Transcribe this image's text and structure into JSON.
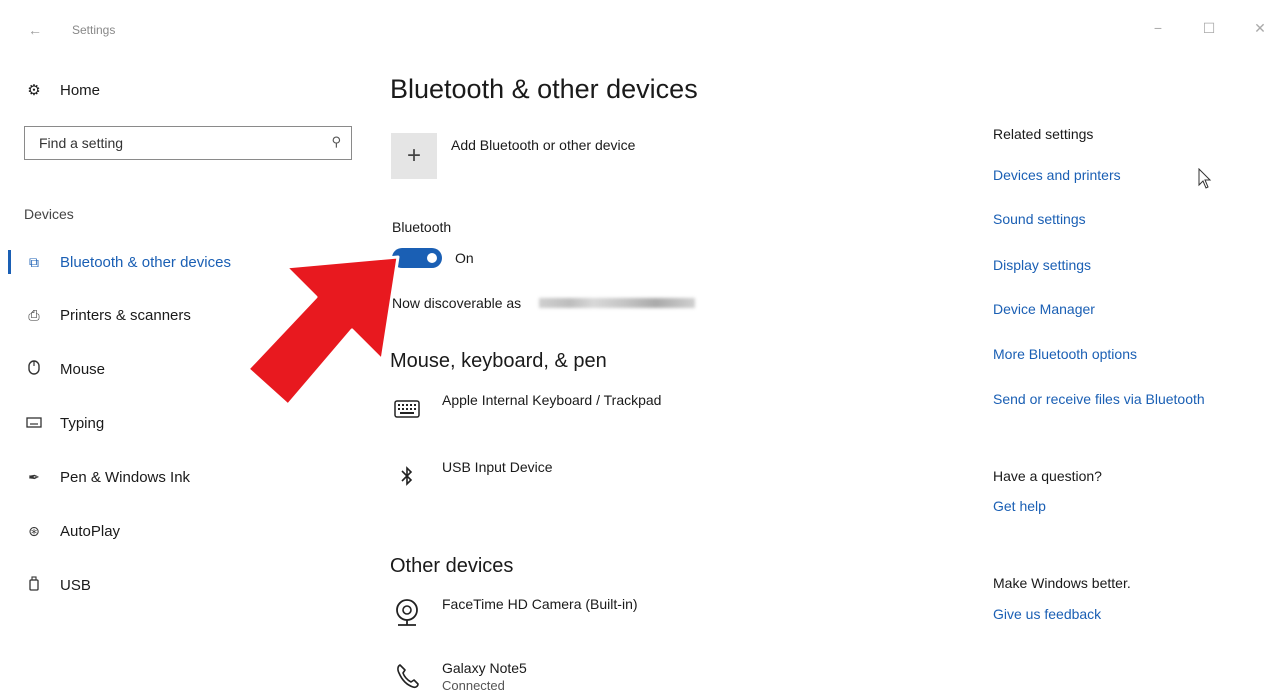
{
  "titlebar": {
    "back_icon": "back-arrow-icon",
    "title": "Settings",
    "minimize": "−",
    "maximize": "☐",
    "close": "✕"
  },
  "nav": {
    "home_label": "Home",
    "search_placeholder": "Find a setting",
    "section_label": "Devices",
    "items": [
      {
        "label": "Bluetooth & other devices",
        "icon": "bluetooth-devices-icon",
        "active": true
      },
      {
        "label": "Printers & scanners",
        "icon": "printer-icon"
      },
      {
        "label": "Mouse",
        "icon": "mouse-icon"
      },
      {
        "label": "Typing",
        "icon": "keyboard-icon"
      },
      {
        "label": "Pen & Windows Ink",
        "icon": "pen-icon"
      },
      {
        "label": "AutoPlay",
        "icon": "autoplay-icon"
      },
      {
        "label": "USB",
        "icon": "usb-icon"
      }
    ]
  },
  "main": {
    "title": "Bluetooth & other devices",
    "add_device_label": "Add Bluetooth or other device",
    "bluetooth_heading": "Bluetooth",
    "bluetooth_state": "On",
    "discoverable_text": "Now discoverable as",
    "mouse_section": "Mouse, keyboard, & pen",
    "mouse_devices": [
      {
        "name": "Apple Internal Keyboard / Trackpad",
        "icon": "keyboard-icon"
      },
      {
        "name": "USB Input Device",
        "icon": "bluetooth-icon"
      }
    ],
    "other_section": "Other devices",
    "other_devices": [
      {
        "name": "FaceTime HD Camera (Built-in)",
        "icon": "webcam-icon"
      },
      {
        "name": "Galaxy Note5",
        "status": "Connected",
        "icon": "phone-icon"
      }
    ]
  },
  "related": {
    "heading": "Related settings",
    "links": [
      "Devices and printers",
      "Sound settings",
      "Display settings",
      "Device Manager",
      "More Bluetooth options",
      "Send or receive files via Bluetooth"
    ],
    "question_heading": "Have a question?",
    "help_link": "Get help",
    "better_heading": "Make Windows better.",
    "feedback_link": "Give us feedback"
  },
  "colors": {
    "accent": "#1a5fb4",
    "arrow": "#e8191f"
  }
}
